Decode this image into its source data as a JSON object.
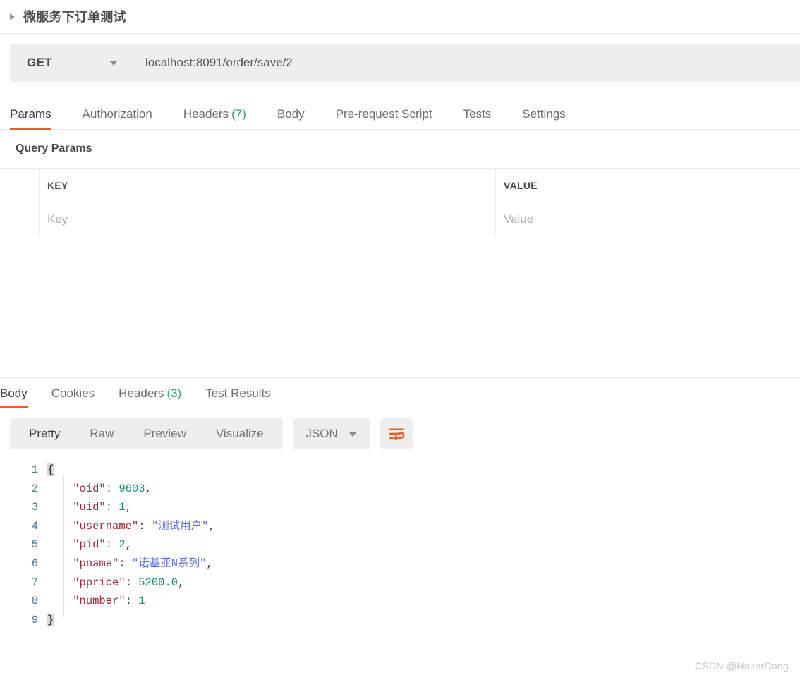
{
  "breadcrumb": {
    "collapse_icon": "triangle-right-icon",
    "title": "微服务下订单测试"
  },
  "request": {
    "method": "GET",
    "url": "localhost:8091/order/save/2",
    "tabs": [
      {
        "label": "Params",
        "count": "",
        "active": true
      },
      {
        "label": "Authorization",
        "count": "",
        "active": false
      },
      {
        "label": "Headers",
        "count": "(7)",
        "active": false
      },
      {
        "label": "Body",
        "count": "",
        "active": false
      },
      {
        "label": "Pre-request Script",
        "count": "",
        "active": false
      },
      {
        "label": "Tests",
        "count": "",
        "active": false
      },
      {
        "label": "Settings",
        "count": "",
        "active": false
      }
    ],
    "query_params": {
      "section_title": "Query Params",
      "columns": [
        "KEY",
        "VALUE"
      ],
      "rows": [
        {
          "key_placeholder": "Key",
          "value_placeholder": "Value"
        }
      ]
    }
  },
  "response": {
    "tabs": [
      {
        "label": "Body",
        "count": "",
        "active": true
      },
      {
        "label": "Cookies",
        "count": "",
        "active": false
      },
      {
        "label": "Headers",
        "count": "(3)",
        "active": false
      },
      {
        "label": "Test Results",
        "count": "",
        "active": false
      }
    ],
    "view_modes": [
      {
        "label": "Pretty",
        "active": true
      },
      {
        "label": "Raw",
        "active": false
      },
      {
        "label": "Preview",
        "active": false
      },
      {
        "label": "Visualize",
        "active": false
      }
    ],
    "format": "JSON",
    "wrap_icon": "word-wrap-icon",
    "body_lines": [
      {
        "n": "1",
        "segments": [
          {
            "t": "{",
            "c": "brace"
          }
        ]
      },
      {
        "n": "2",
        "segments": [
          {
            "t": "    ",
            "c": "k-punct"
          },
          {
            "t": "\"oid\"",
            "c": "k-key"
          },
          {
            "t": ": ",
            "c": "k-punct"
          },
          {
            "t": "9603",
            "c": "k-num"
          },
          {
            "t": ",",
            "c": "k-punct"
          }
        ]
      },
      {
        "n": "3",
        "segments": [
          {
            "t": "    ",
            "c": "k-punct"
          },
          {
            "t": "\"uid\"",
            "c": "k-key"
          },
          {
            "t": ": ",
            "c": "k-punct"
          },
          {
            "t": "1",
            "c": "k-num"
          },
          {
            "t": ",",
            "c": "k-punct"
          }
        ]
      },
      {
        "n": "4",
        "segments": [
          {
            "t": "    ",
            "c": "k-punct"
          },
          {
            "t": "\"username\"",
            "c": "k-key"
          },
          {
            "t": ": ",
            "c": "k-punct"
          },
          {
            "t": "\"测试用户\"",
            "c": "k-str"
          },
          {
            "t": ",",
            "c": "k-punct"
          }
        ]
      },
      {
        "n": "5",
        "segments": [
          {
            "t": "    ",
            "c": "k-punct"
          },
          {
            "t": "\"pid\"",
            "c": "k-key"
          },
          {
            "t": ": ",
            "c": "k-punct"
          },
          {
            "t": "2",
            "c": "k-num"
          },
          {
            "t": ",",
            "c": "k-punct"
          }
        ]
      },
      {
        "n": "6",
        "segments": [
          {
            "t": "    ",
            "c": "k-punct"
          },
          {
            "t": "\"pname\"",
            "c": "k-key"
          },
          {
            "t": ": ",
            "c": "k-punct"
          },
          {
            "t": "\"诺基亚N系列\"",
            "c": "k-str"
          },
          {
            "t": ",",
            "c": "k-punct"
          }
        ]
      },
      {
        "n": "7",
        "segments": [
          {
            "t": "    ",
            "c": "k-punct"
          },
          {
            "t": "\"pprice\"",
            "c": "k-key"
          },
          {
            "t": ": ",
            "c": "k-punct"
          },
          {
            "t": "5200.0",
            "c": "k-num"
          },
          {
            "t": ",",
            "c": "k-punct"
          }
        ]
      },
      {
        "n": "8",
        "segments": [
          {
            "t": "    ",
            "c": "k-punct"
          },
          {
            "t": "\"number\"",
            "c": "k-key"
          },
          {
            "t": ": ",
            "c": "k-punct"
          },
          {
            "t": "1",
            "c": "k-num"
          }
        ]
      },
      {
        "n": "9",
        "segments": [
          {
            "t": "}",
            "c": "brace"
          }
        ]
      }
    ]
  },
  "watermark": "CSDN @HakerDong",
  "colors": {
    "accent": "#ef5b25",
    "count_green": "#30a46c",
    "key_red": "#a52a3c",
    "num_teal": "#138d75",
    "str_blue": "#5a6fd6",
    "gutter_blue": "#4b7a95",
    "field_bg": "#eeeeee"
  }
}
